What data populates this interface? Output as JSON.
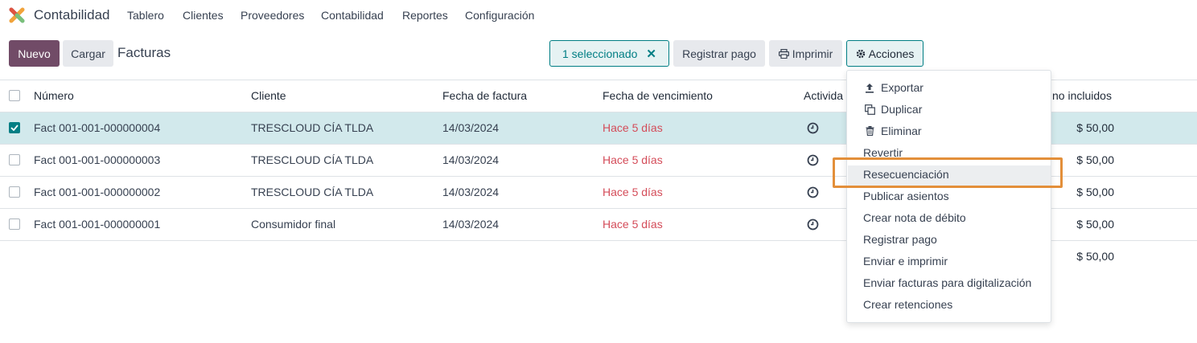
{
  "navbar": {
    "app_name": "Contabilidad",
    "items": [
      "Tablero",
      "Clientes",
      "Proveedores",
      "Contabilidad",
      "Reportes",
      "Configuración"
    ]
  },
  "control_panel": {
    "new_label": "Nuevo",
    "load_label": "Cargar",
    "breadcrumb": "Facturas",
    "selection_badge": "1 seleccionado",
    "register_payment_label": "Registrar pago",
    "print_label": "Imprimir",
    "actions_label": "Acciones"
  },
  "table": {
    "headers": {
      "number": "Número",
      "customer": "Cliente",
      "invoice_date": "Fecha de factura",
      "due_date": "Fecha de vencimiento",
      "activity": "Activida",
      "tax_excluded": "no incluidos"
    },
    "rows": [
      {
        "number": "Fact 001-001-000000004",
        "customer": "TRESCLOUD CÍA TLDA",
        "invoice_date": "14/03/2024",
        "due": "Hace 5 días",
        "amount": "$ 50,00",
        "selected": true
      },
      {
        "number": "Fact 001-001-000000003",
        "customer": "TRESCLOUD CÍA TLDA",
        "invoice_date": "14/03/2024",
        "due": "Hace 5 días",
        "amount": "$ 50,00",
        "selected": false
      },
      {
        "number": "Fact 001-001-000000002",
        "customer": "TRESCLOUD CÍA TLDA",
        "invoice_date": "14/03/2024",
        "due": "Hace 5 días",
        "amount": "$ 50,00",
        "selected": false
      },
      {
        "number": "Fact 001-001-000000001",
        "customer": "Consumidor final",
        "invoice_date": "14/03/2024",
        "due": "Hace 5 días",
        "amount": "$ 50,00",
        "selected": false
      }
    ],
    "total": "$ 50,00"
  },
  "actions_menu": {
    "items": [
      {
        "label": "Exportar",
        "icon": "upload-icon"
      },
      {
        "label": "Duplicar",
        "icon": "copy-icon"
      },
      {
        "label": "Eliminar",
        "icon": "trash-icon"
      },
      {
        "label": "Revertir",
        "icon": ""
      },
      {
        "label": "Resecuenciación",
        "icon": ""
      },
      {
        "label": "Publicar asientos",
        "icon": ""
      },
      {
        "label": "Crear nota de débito",
        "icon": ""
      },
      {
        "label": "Registrar pago",
        "icon": ""
      },
      {
        "label": "Enviar e imprimir",
        "icon": ""
      },
      {
        "label": "Enviar facturas para digitalización",
        "icon": ""
      },
      {
        "label": "Crear retenciones",
        "icon": ""
      }
    ],
    "highlighted": "Resecuenciación"
  },
  "colors": {
    "brand": "#714B67",
    "accent": "#017e84",
    "overdue": "#d44c59",
    "annotation": "#e38f3a",
    "selected_row": "#d2e9ec"
  }
}
